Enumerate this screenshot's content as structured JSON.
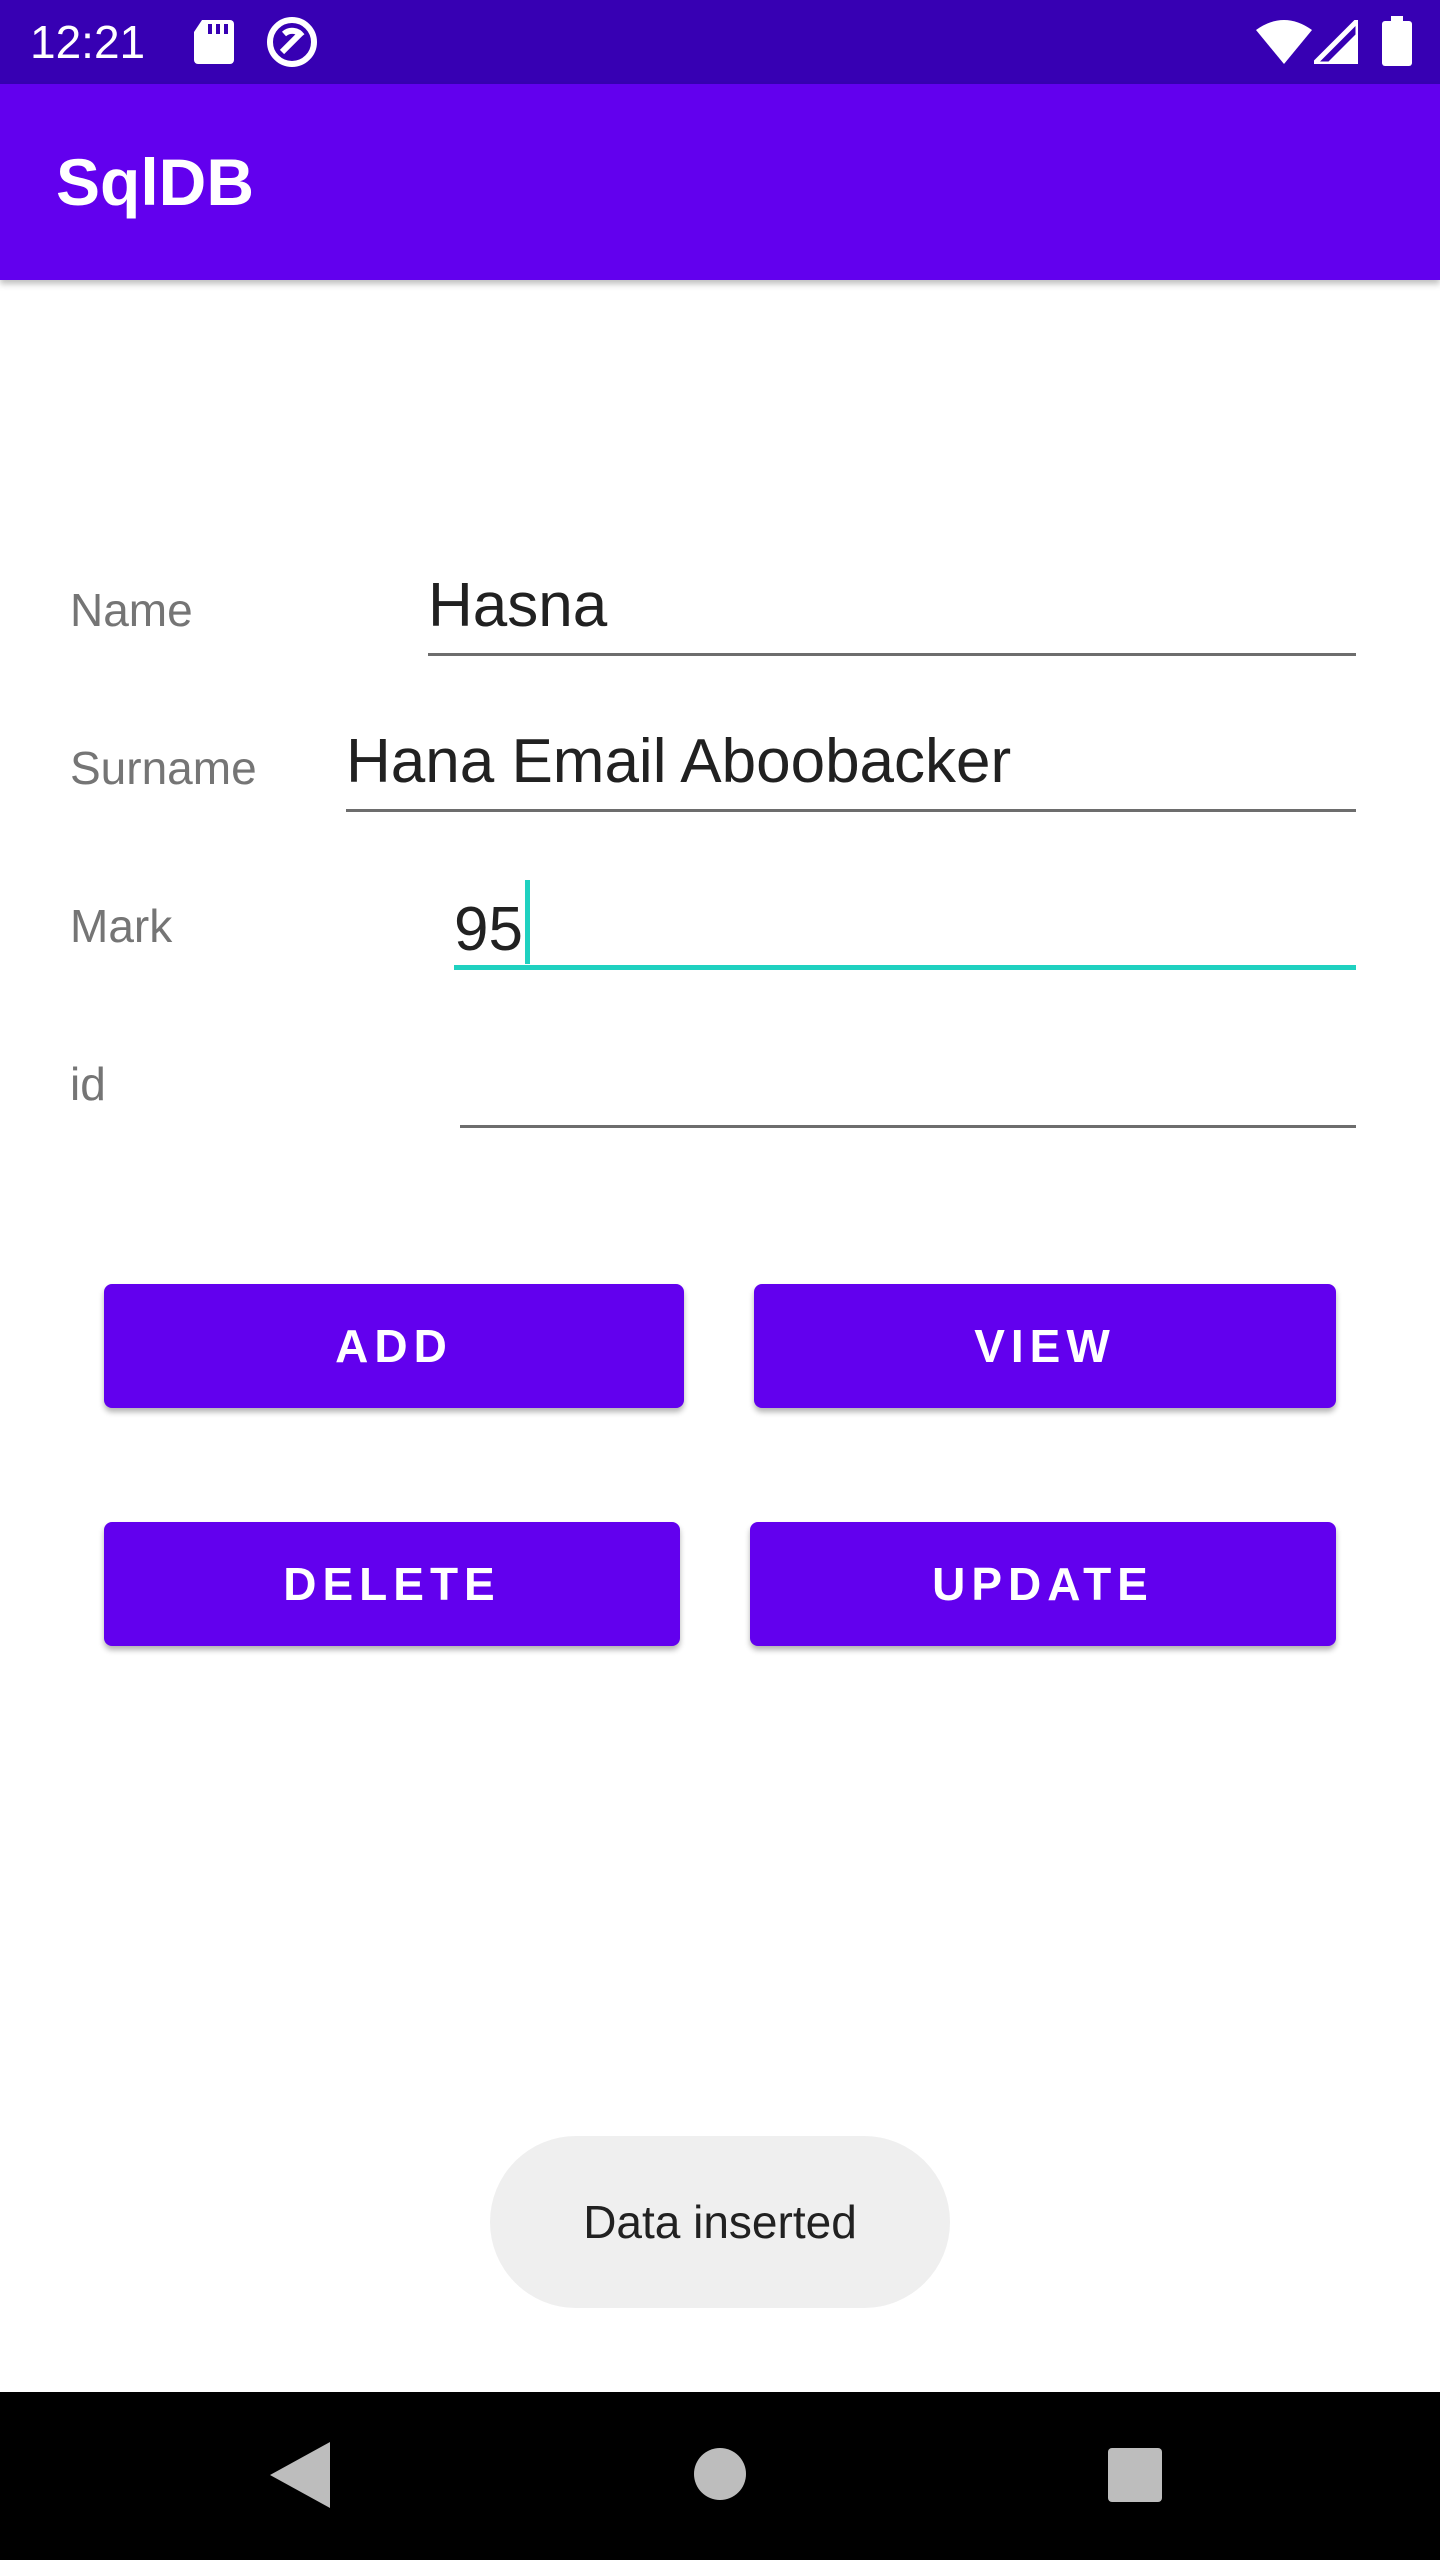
{
  "status_bar": {
    "time": "12:21",
    "icons": [
      "sd-card-icon",
      "sync-icon",
      "wifi-icon",
      "signal-icon",
      "battery-icon"
    ]
  },
  "app_bar": {
    "title": "SqlDB"
  },
  "form": {
    "name_label": "Name",
    "name_value": "Hasna",
    "surname_label": "Surname",
    "surname_value": "Hana Email Aboobacker",
    "mark_label": "Mark",
    "mark_value": "95",
    "id_label": "id",
    "id_value": ""
  },
  "buttons": {
    "add": "ADD",
    "view": "VIEW",
    "delete": "DELETE",
    "update": "UPDATE"
  },
  "toast": {
    "message": "Data inserted"
  },
  "colors": {
    "status_bar": "#3700b3",
    "primary": "#6200ee",
    "focus_accent": "#1fd1c0",
    "toast_bg": "#efefef"
  },
  "nav_bar": {
    "icons": [
      "back-icon",
      "home-icon",
      "recents-icon"
    ]
  }
}
